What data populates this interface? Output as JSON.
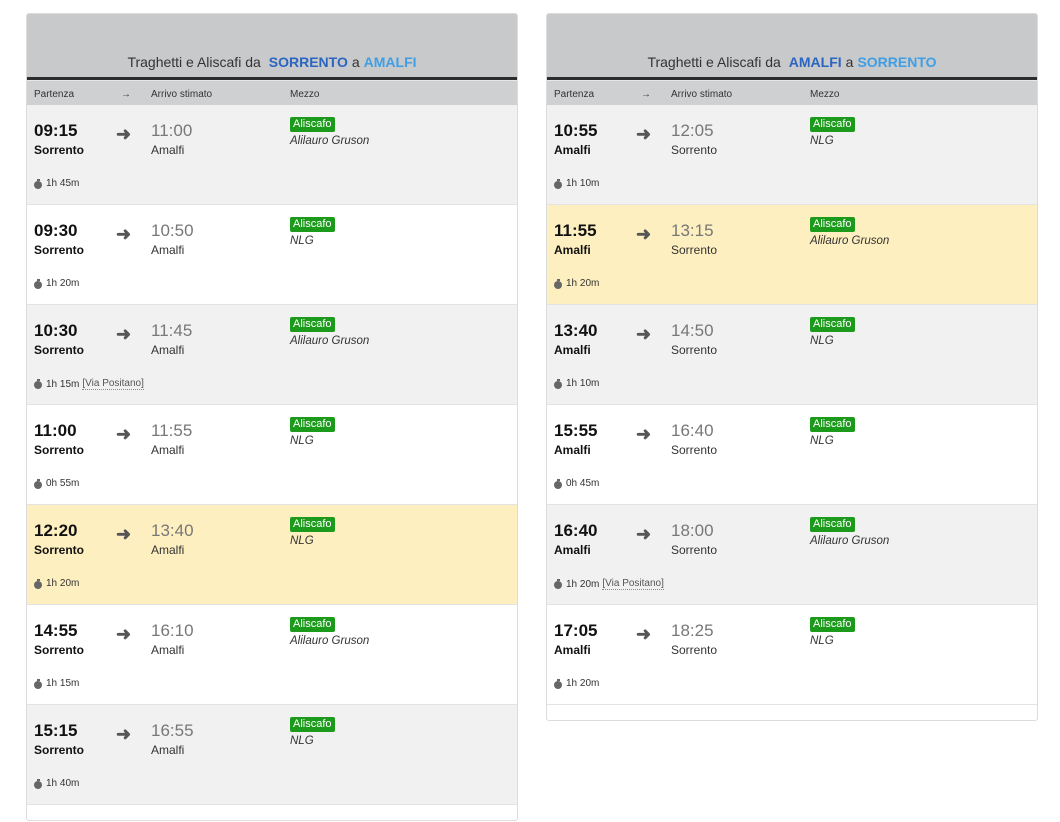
{
  "left": {
    "title": {
      "prefix": "Traghetti e Aliscafi da",
      "from": "SORRENTO",
      "sep": "a",
      "to": "AMALFI"
    },
    "columns": {
      "departure": "Partenza",
      "arrow": "→",
      "arrival": "Arrivo stimato",
      "vessel": "Mezzo"
    },
    "trips": [
      {
        "dep": "09:15",
        "from": "Sorrento",
        "arr": "11:00",
        "to": "Amalfi",
        "type": "Aliscafo",
        "operator": "Alilauro Gruson",
        "duration": "1h 45m"
      },
      {
        "dep": "09:30",
        "from": "Sorrento",
        "arr": "10:50",
        "to": "Amalfi",
        "type": "Aliscafo",
        "operator": "NLG",
        "duration": "1h 20m"
      },
      {
        "dep": "10:30",
        "from": "Sorrento",
        "arr": "11:45",
        "to": "Amalfi",
        "type": "Aliscafo",
        "operator": "Alilauro Gruson",
        "duration": "1h 15m",
        "via": "[Via Positano]"
      },
      {
        "dep": "11:00",
        "from": "Sorrento",
        "arr": "11:55",
        "to": "Amalfi",
        "type": "Aliscafo",
        "operator": "NLG",
        "duration": "0h 55m"
      },
      {
        "dep": "12:20",
        "from": "Sorrento",
        "arr": "13:40",
        "to": "Amalfi",
        "type": "Aliscafo",
        "operator": "NLG",
        "duration": "1h 20m",
        "highlighted": true
      },
      {
        "dep": "14:55",
        "from": "Sorrento",
        "arr": "16:10",
        "to": "Amalfi",
        "type": "Aliscafo",
        "operator": "Alilauro Gruson",
        "duration": "1h 15m"
      },
      {
        "dep": "15:15",
        "from": "Sorrento",
        "arr": "16:55",
        "to": "Amalfi",
        "type": "Aliscafo",
        "operator": "NLG",
        "duration": "1h 40m"
      }
    ]
  },
  "right": {
    "title": {
      "prefix": "Traghetti e Aliscafi da",
      "from": "AMALFI",
      "sep": "a",
      "to": "SORRENTO"
    },
    "columns": {
      "departure": "Partenza",
      "arrow": "→",
      "arrival": "Arrivo stimato",
      "vessel": "Mezzo"
    },
    "trips": [
      {
        "dep": "10:55",
        "from": "Amalfi",
        "arr": "12:05",
        "to": "Sorrento",
        "type": "Aliscafo",
        "operator": "NLG",
        "duration": "1h 10m"
      },
      {
        "dep": "11:55",
        "from": "Amalfi",
        "arr": "13:15",
        "to": "Sorrento",
        "type": "Aliscafo",
        "operator": "Alilauro Gruson",
        "duration": "1h 20m",
        "highlighted": true
      },
      {
        "dep": "13:40",
        "from": "Amalfi",
        "arr": "14:50",
        "to": "Sorrento",
        "type": "Aliscafo",
        "operator": "NLG",
        "duration": "1h 10m"
      },
      {
        "dep": "15:55",
        "from": "Amalfi",
        "arr": "16:40",
        "to": "Sorrento",
        "type": "Aliscafo",
        "operator": "NLG",
        "duration": "0h 45m"
      },
      {
        "dep": "16:40",
        "from": "Amalfi",
        "arr": "18:00",
        "to": "Sorrento",
        "type": "Aliscafo",
        "operator": "Alilauro Gruson",
        "duration": "1h 20m",
        "via": "[Via Positano]"
      },
      {
        "dep": "17:05",
        "from": "Amalfi",
        "arr": "18:25",
        "to": "Sorrento",
        "type": "Aliscafo",
        "operator": "NLG",
        "duration": "1h 20m"
      }
    ]
  },
  "colors": {
    "from_city": "#2b65c0",
    "to_city": "#3e9fe6",
    "badge": "#1c9a1c",
    "highlight": "#fdefbf"
  },
  "icons": {
    "arrow": "arrow-right-icon",
    "duration": "stopwatch-icon"
  }
}
